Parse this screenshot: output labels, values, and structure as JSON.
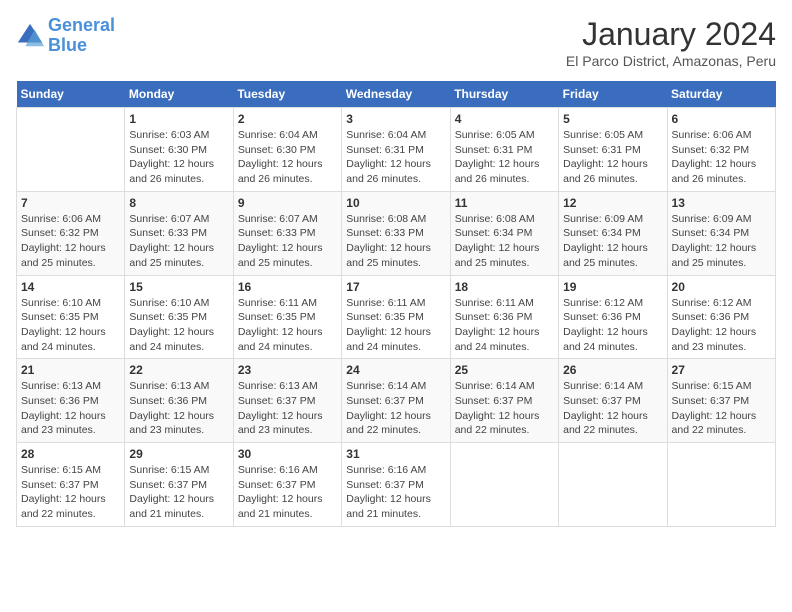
{
  "logo": {
    "line1": "General",
    "line2": "Blue"
  },
  "title": "January 2024",
  "subtitle": "El Parco District, Amazonas, Peru",
  "days_of_week": [
    "Sunday",
    "Monday",
    "Tuesday",
    "Wednesday",
    "Thursday",
    "Friday",
    "Saturday"
  ],
  "weeks": [
    [
      {
        "day": "",
        "info": ""
      },
      {
        "day": "1",
        "info": "Sunrise: 6:03 AM\nSunset: 6:30 PM\nDaylight: 12 hours\nand 26 minutes."
      },
      {
        "day": "2",
        "info": "Sunrise: 6:04 AM\nSunset: 6:30 PM\nDaylight: 12 hours\nand 26 minutes."
      },
      {
        "day": "3",
        "info": "Sunrise: 6:04 AM\nSunset: 6:31 PM\nDaylight: 12 hours\nand 26 minutes."
      },
      {
        "day": "4",
        "info": "Sunrise: 6:05 AM\nSunset: 6:31 PM\nDaylight: 12 hours\nand 26 minutes."
      },
      {
        "day": "5",
        "info": "Sunrise: 6:05 AM\nSunset: 6:31 PM\nDaylight: 12 hours\nand 26 minutes."
      },
      {
        "day": "6",
        "info": "Sunrise: 6:06 AM\nSunset: 6:32 PM\nDaylight: 12 hours\nand 26 minutes."
      }
    ],
    [
      {
        "day": "7",
        "info": "Sunrise: 6:06 AM\nSunset: 6:32 PM\nDaylight: 12 hours\nand 25 minutes."
      },
      {
        "day": "8",
        "info": "Sunrise: 6:07 AM\nSunset: 6:33 PM\nDaylight: 12 hours\nand 25 minutes."
      },
      {
        "day": "9",
        "info": "Sunrise: 6:07 AM\nSunset: 6:33 PM\nDaylight: 12 hours\nand 25 minutes."
      },
      {
        "day": "10",
        "info": "Sunrise: 6:08 AM\nSunset: 6:33 PM\nDaylight: 12 hours\nand 25 minutes."
      },
      {
        "day": "11",
        "info": "Sunrise: 6:08 AM\nSunset: 6:34 PM\nDaylight: 12 hours\nand 25 minutes."
      },
      {
        "day": "12",
        "info": "Sunrise: 6:09 AM\nSunset: 6:34 PM\nDaylight: 12 hours\nand 25 minutes."
      },
      {
        "day": "13",
        "info": "Sunrise: 6:09 AM\nSunset: 6:34 PM\nDaylight: 12 hours\nand 25 minutes."
      }
    ],
    [
      {
        "day": "14",
        "info": "Sunrise: 6:10 AM\nSunset: 6:35 PM\nDaylight: 12 hours\nand 24 minutes."
      },
      {
        "day": "15",
        "info": "Sunrise: 6:10 AM\nSunset: 6:35 PM\nDaylight: 12 hours\nand 24 minutes."
      },
      {
        "day": "16",
        "info": "Sunrise: 6:11 AM\nSunset: 6:35 PM\nDaylight: 12 hours\nand 24 minutes."
      },
      {
        "day": "17",
        "info": "Sunrise: 6:11 AM\nSunset: 6:35 PM\nDaylight: 12 hours\nand 24 minutes."
      },
      {
        "day": "18",
        "info": "Sunrise: 6:11 AM\nSunset: 6:36 PM\nDaylight: 12 hours\nand 24 minutes."
      },
      {
        "day": "19",
        "info": "Sunrise: 6:12 AM\nSunset: 6:36 PM\nDaylight: 12 hours\nand 24 minutes."
      },
      {
        "day": "20",
        "info": "Sunrise: 6:12 AM\nSunset: 6:36 PM\nDaylight: 12 hours\nand 23 minutes."
      }
    ],
    [
      {
        "day": "21",
        "info": "Sunrise: 6:13 AM\nSunset: 6:36 PM\nDaylight: 12 hours\nand 23 minutes."
      },
      {
        "day": "22",
        "info": "Sunrise: 6:13 AM\nSunset: 6:36 PM\nDaylight: 12 hours\nand 23 minutes."
      },
      {
        "day": "23",
        "info": "Sunrise: 6:13 AM\nSunset: 6:37 PM\nDaylight: 12 hours\nand 23 minutes."
      },
      {
        "day": "24",
        "info": "Sunrise: 6:14 AM\nSunset: 6:37 PM\nDaylight: 12 hours\nand 22 minutes."
      },
      {
        "day": "25",
        "info": "Sunrise: 6:14 AM\nSunset: 6:37 PM\nDaylight: 12 hours\nand 22 minutes."
      },
      {
        "day": "26",
        "info": "Sunrise: 6:14 AM\nSunset: 6:37 PM\nDaylight: 12 hours\nand 22 minutes."
      },
      {
        "day": "27",
        "info": "Sunrise: 6:15 AM\nSunset: 6:37 PM\nDaylight: 12 hours\nand 22 minutes."
      }
    ],
    [
      {
        "day": "28",
        "info": "Sunrise: 6:15 AM\nSunset: 6:37 PM\nDaylight: 12 hours\nand 22 minutes."
      },
      {
        "day": "29",
        "info": "Sunrise: 6:15 AM\nSunset: 6:37 PM\nDaylight: 12 hours\nand 21 minutes."
      },
      {
        "day": "30",
        "info": "Sunrise: 6:16 AM\nSunset: 6:37 PM\nDaylight: 12 hours\nand 21 minutes."
      },
      {
        "day": "31",
        "info": "Sunrise: 6:16 AM\nSunset: 6:37 PM\nDaylight: 12 hours\nand 21 minutes."
      },
      {
        "day": "",
        "info": ""
      },
      {
        "day": "",
        "info": ""
      },
      {
        "day": "",
        "info": ""
      }
    ]
  ]
}
